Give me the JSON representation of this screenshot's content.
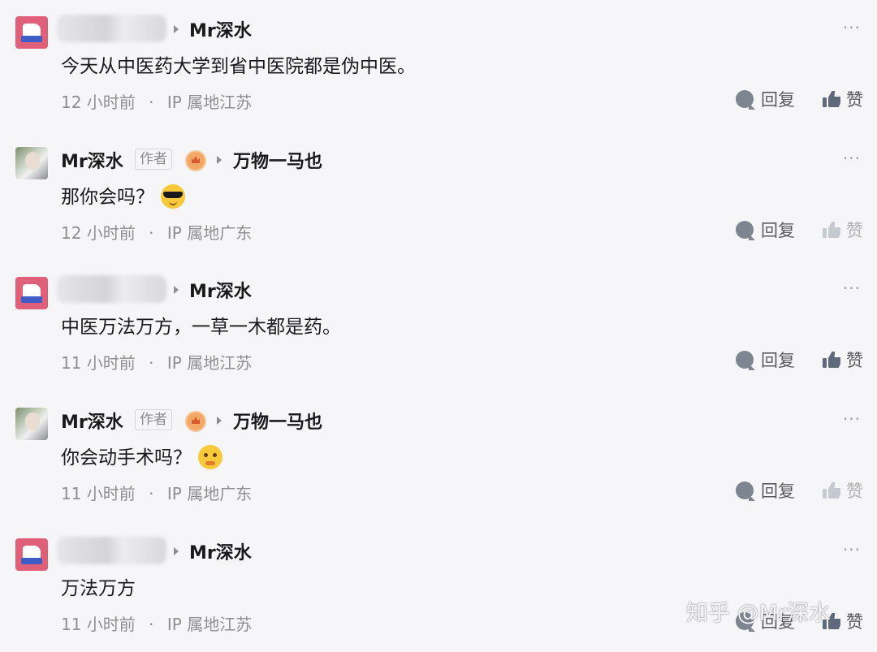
{
  "comments": [
    {
      "reply_to": "Mr深水",
      "content": "今天从中医药大学到省中医院都是伪中医。",
      "time": "12 小时前",
      "ip": "IP 属地江苏",
      "reply_label": "回复",
      "like_label": "赞"
    },
    {
      "author": "Mr深水",
      "author_tag": "作者",
      "reply_to": "万物一马也",
      "content": "那你会吗？",
      "emoji": "cool-face-emoji",
      "time": "12 小时前",
      "ip": "IP 属地广东",
      "reply_label": "回复",
      "like_label": "赞"
    },
    {
      "reply_to": "Mr深水",
      "content": "中医万法万方，一草一木都是药。",
      "time": "11 小时前",
      "ip": "IP 属地江苏",
      "reply_label": "回复",
      "like_label": "赞"
    },
    {
      "author": "Mr深水",
      "author_tag": "作者",
      "reply_to": "万物一马也",
      "content": "你会动手术吗？",
      "emoji": "thinking-face-emoji",
      "time": "11 小时前",
      "ip": "IP 属地广东",
      "reply_label": "回复",
      "like_label": "赞"
    },
    {
      "reply_to": "Mr深水",
      "content": "万法万方",
      "time": "11 小时前",
      "ip": "IP 属地江苏",
      "reply_label": "回复",
      "like_label": "赞"
    }
  ],
  "more_label": "···",
  "meta_separator": "·",
  "watermark": "知乎 @Mr深水",
  "colors": {
    "background": "#f6f6f8",
    "text": "#1a1a1a",
    "meta": "#8e8e93",
    "avatar_pink": "#e0607a"
  }
}
